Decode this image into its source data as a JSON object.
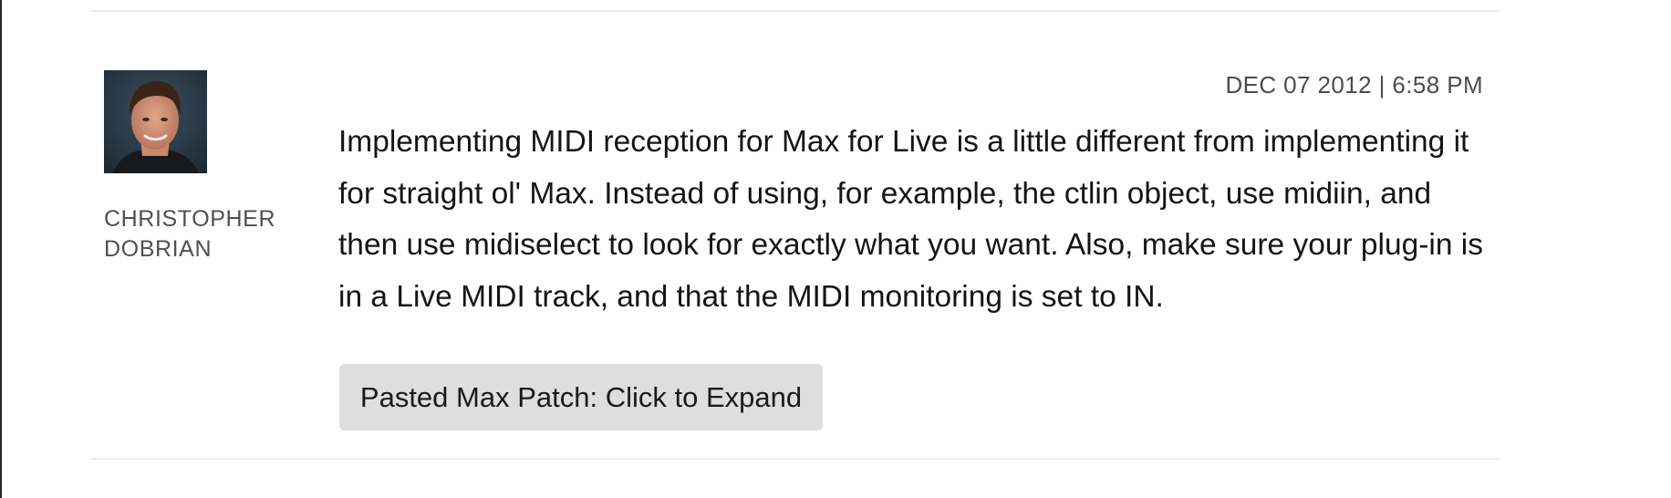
{
  "comment": {
    "author": {
      "first_name": "CHRISTOPHER",
      "last_name": "DOBRIAN",
      "avatar": "author-photo"
    },
    "timestamp": "DEC 07 2012 | 6:58 PM",
    "body": "Implementing MIDI reception for Max for Live is a little different from implementing it for straight ol' Max. Instead of using, for example, the ctlin object, use midiin, and then use midiselect to look for exactly what you want. Also, make sure your plug-in is in a Live MIDI track, and that the MIDI monitoring is set to IN.",
    "expand_button_label": "Pasted Max Patch: Click to Expand"
  },
  "colors": {
    "divider": "#ececec",
    "button_bg": "#dedede",
    "text_primary": "#151515",
    "text_secondary": "#4d4d4d"
  }
}
